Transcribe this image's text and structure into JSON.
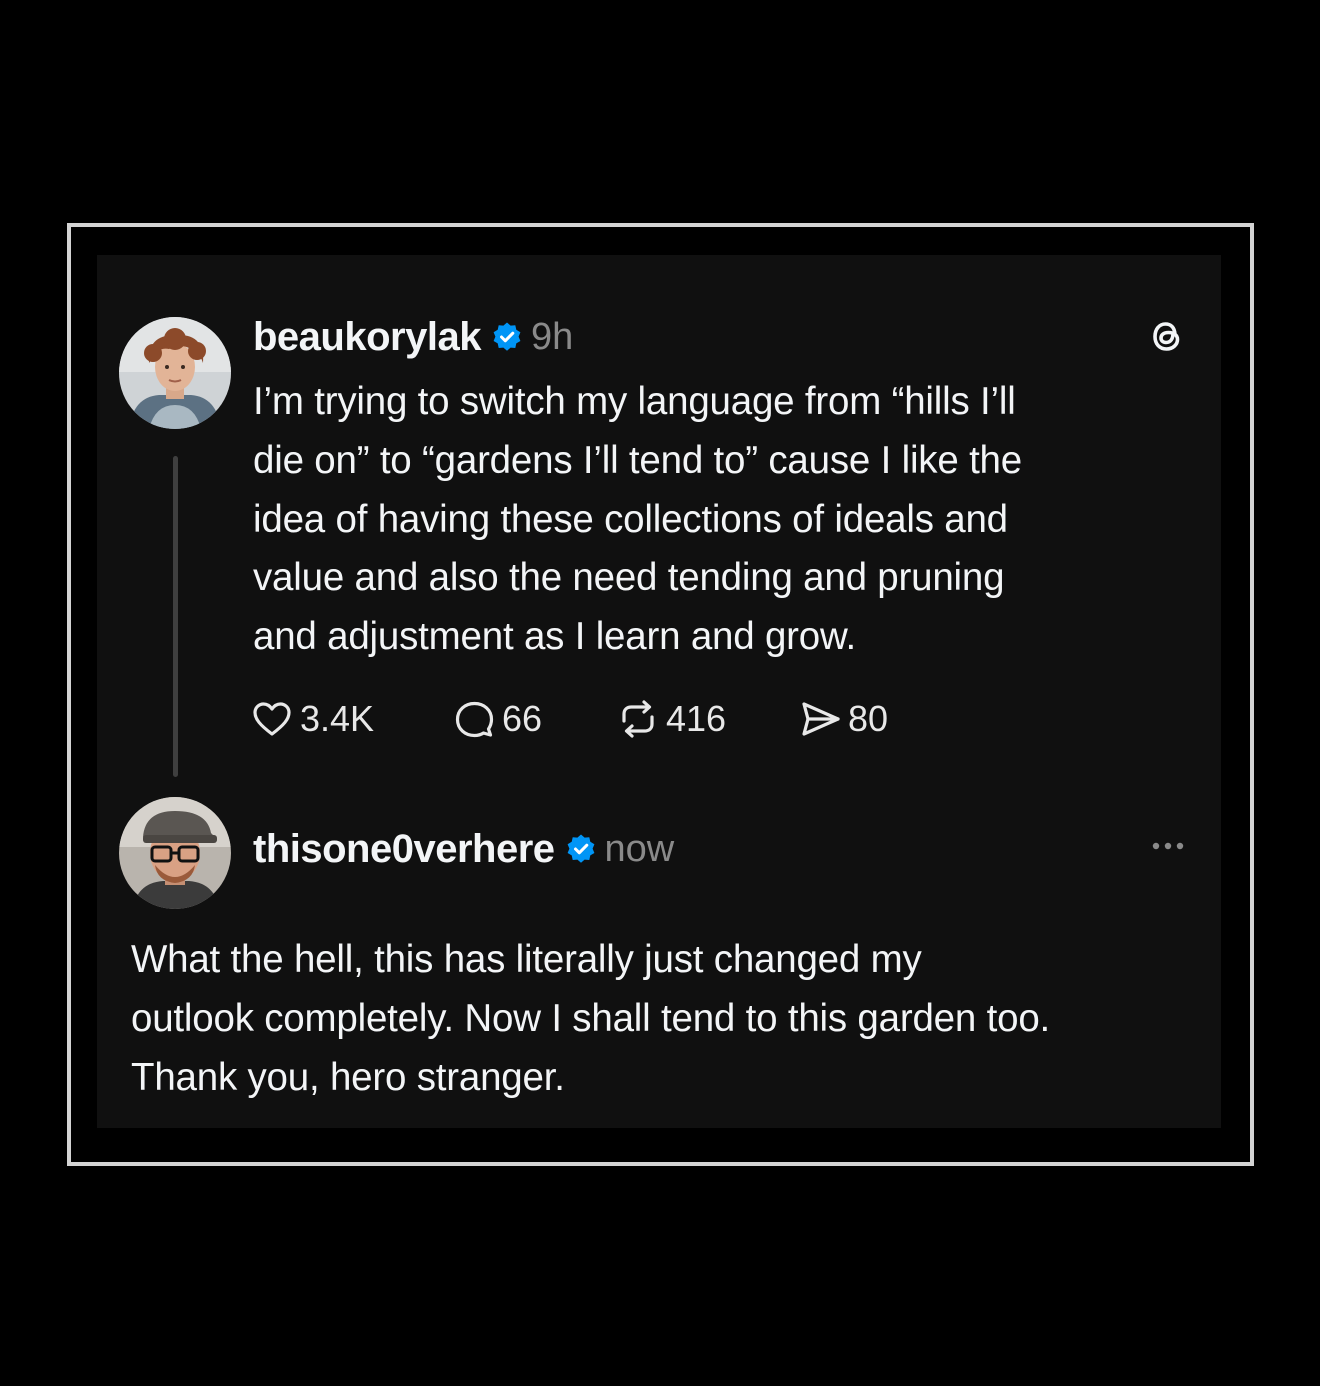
{
  "post": {
    "author": "beaukorylak",
    "time": "9h",
    "text_lines": [
      "I’m trying to switch my language from “hills I’ll",
      "die on” to “gardens I’ll tend to” cause I like the",
      "idea of having these collections of ideals and",
      "value and also the need tending and pruning",
      "and adjustment as I learn and grow."
    ],
    "likes": "3.4K",
    "replies": "66",
    "reposts": "416",
    "shares": "80"
  },
  "reply": {
    "author": "thisone0verhere",
    "time": "now",
    "text_lines": [
      "What the hell, this has literally just changed my",
      "outlook completely. Now I shall tend to this garden too.",
      "Thank you, hero stranger."
    ]
  },
  "icons": {
    "verified": "verified-badge-icon",
    "brand": "threads-logo-icon",
    "like": "heart-icon",
    "reply": "speech-bubble-icon",
    "repost": "repost-arrows-icon",
    "share": "send-icon",
    "more": "more-dots-icon"
  },
  "colors": {
    "background": "#000000",
    "card": "#101010",
    "frame": "#d4d4d4",
    "text": "#f3f5f7",
    "muted": "#8a8a8a",
    "verified": "#0095f6"
  }
}
